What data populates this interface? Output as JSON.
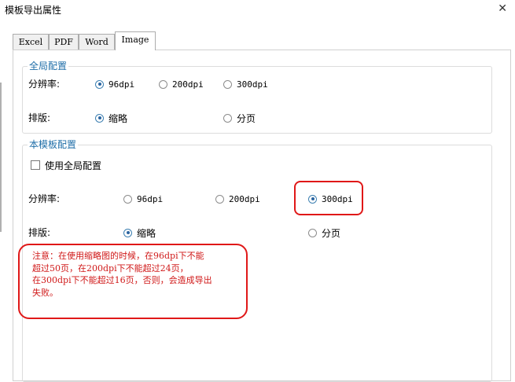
{
  "window": {
    "title": "模板导出属性",
    "close_glyph": "✕"
  },
  "tabs": [
    {
      "label": "Excel",
      "active": false
    },
    {
      "label": "PDF",
      "active": false
    },
    {
      "label": "Word",
      "active": false
    },
    {
      "label": "Image",
      "active": true
    }
  ],
  "global_config": {
    "legend": "全局配置",
    "resolution_label": "分辨率:",
    "resolution_options": [
      "96dpi",
      "200dpi",
      "300dpi"
    ],
    "resolution_selected": "96dpi",
    "layout_label": "排版:",
    "layout_options": [
      "缩略",
      "分页"
    ],
    "layout_selected": "缩略"
  },
  "template_config": {
    "legend": "本模板配置",
    "use_global_label": "使用全局配置",
    "use_global_checked": false,
    "resolution_label": "分辨率:",
    "resolution_options": [
      "96dpi",
      "200dpi",
      "300dpi"
    ],
    "resolution_selected": "300dpi",
    "layout_label": "排版:",
    "layout_options": [
      "缩略",
      "分页"
    ],
    "layout_selected": "缩略"
  },
  "note": {
    "lines": [
      "注意：在使用缩略图的时候，在96dpi下不能",
      "超过50页，在200dpi下不能超过24页，",
      "在300dpi下不能超过16页，否则，会造成导出",
      "失败。"
    ],
    "highlight_color": "#e01818"
  }
}
